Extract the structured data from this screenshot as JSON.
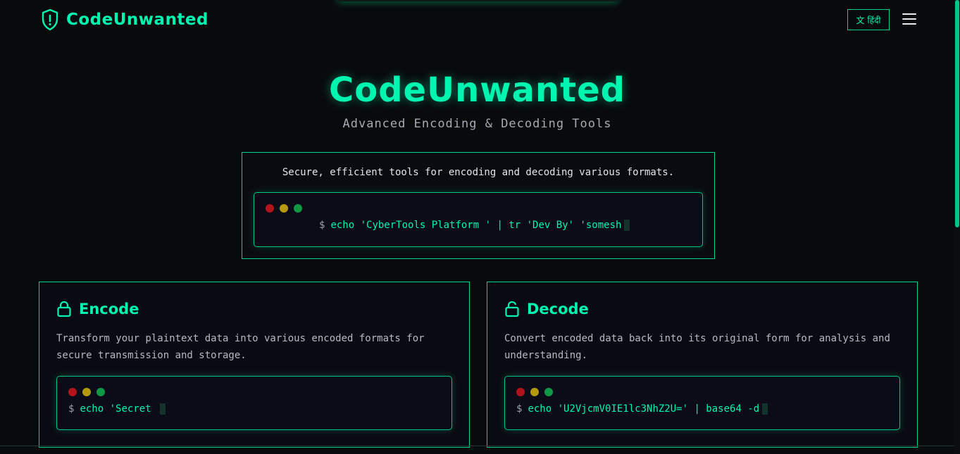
{
  "brand": {
    "name": "CodeUnwanted",
    "icon": "shield-alert-icon"
  },
  "header": {
    "language_label": "हिंदी",
    "language_icon": "translate-icon",
    "menu_icon": "hamburger-menu-icon"
  },
  "hero": {
    "title": "CodeUnwanted",
    "subtitle": "Advanced Encoding & Decoding Tools",
    "intro": "Secure, efficient tools for encoding and decoding various formats.",
    "terminal": {
      "prompt": "$",
      "command": "echo 'CyberTools Platform ' | tr 'Dev By' 'somesh"
    }
  },
  "cards": [
    {
      "title": "Encode",
      "icon": "lock-icon",
      "description": "Transform your plaintext data into various encoded formats for secure transmission and storage.",
      "terminal": {
        "prompt": "$",
        "command": "echo 'Secret "
      }
    },
    {
      "title": "Decode",
      "icon": "unlock-icon",
      "description": "Convert encoded data back into its original form for analysis and understanding.",
      "terminal": {
        "prompt": "$",
        "command": "echo 'U2VjcmV0IE1lc3NhZ2U=' | base64 -d"
      }
    }
  ],
  "colors": {
    "accent": "#00f5b0",
    "border": "#00d68f",
    "background": "#090a0c",
    "dot_red": "#b3141b",
    "dot_yellow": "#b39a0f",
    "dot_green": "#0e9a45"
  }
}
